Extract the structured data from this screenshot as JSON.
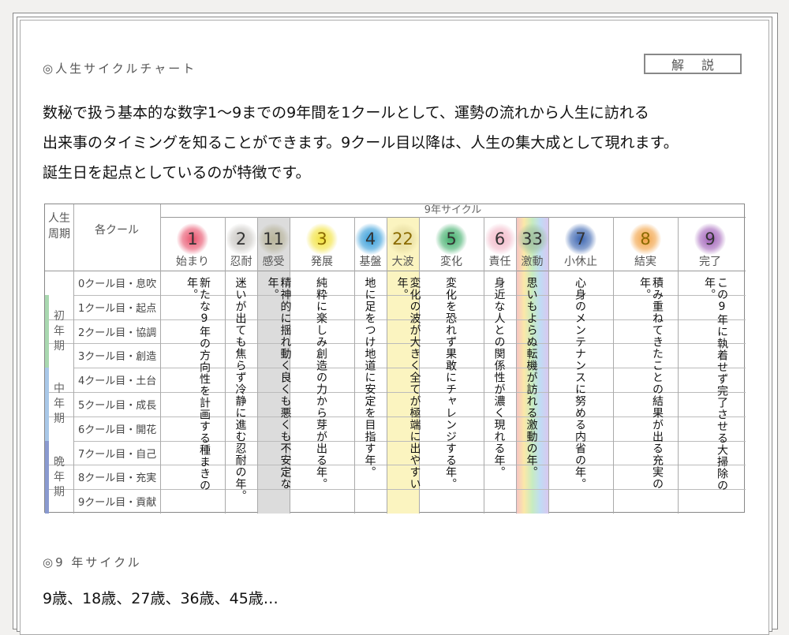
{
  "section1_title": "◎人生サイクルチャート",
  "kaisetsu_button": "解説",
  "intro": [
    "数秘で扱う基本的な数字1〜9までの9年間を1クールとして、運勢の流れから人生に訪れる",
    "出来事のタイミングを知ることができます。9クール目以降は、人生の集大成として現れます。",
    "誕生日を起点としているのが特徴です。"
  ],
  "table": {
    "col_header_life": "人生周期",
    "col_header_cour": "各クール",
    "cycle_header": "9年サイクル",
    "columns": [
      {
        "num": "1",
        "name": "始まり",
        "color": "#e8506a",
        "text": "新たな9年の方向性を計画する種まきの年。"
      },
      {
        "num": "2",
        "name": "忍耐",
        "color": "#c9c6c2",
        "text": "迷いが出ても焦らず冷静に進む忍耐の年。"
      },
      {
        "num": "11",
        "name": "感受",
        "color": "#b8b49a",
        "text": "精神的に揺れ動く良くも悪くも不安定な年。"
      },
      {
        "num": "3",
        "name": "発展",
        "color": "#f2e23c",
        "text": "純粋に楽しみ創造の力から芽が出る年。"
      },
      {
        "num": "4",
        "name": "基盤",
        "color": "#2f9ad8",
        "text": "地に足をつけ地道に安定を目指す年。"
      },
      {
        "num": "22",
        "name": "大波",
        "color": "#e6dca0",
        "text": "変化の波が大きく全てが極端に出やすい年。"
      },
      {
        "num": "5",
        "name": "変化",
        "color": "#3fae6a",
        "text": "変化を恐れず果敢にチャレンジする年。"
      },
      {
        "num": "6",
        "name": "責任",
        "color": "#f2b8c8",
        "text": "身近な人との関係性が濃く現れる年。"
      },
      {
        "num": "33",
        "name": "激動",
        "color": "#a0c0a0",
        "text": "思いもよらぬ転機が訪れる激動の年。"
      },
      {
        "num": "7",
        "name": "小休止",
        "color": "#3a64b0",
        "text": "心身のメンテナンスに努める内省の年。"
      },
      {
        "num": "8",
        "name": "結実",
        "color": "#f2a040",
        "text": "積み重ねてきたことの結果が出る充実の年。"
      },
      {
        "num": "9",
        "name": "完了",
        "color": "#a060b8",
        "text": "この9年に執着せず完了させる大掃除の年。"
      }
    ],
    "rows": [
      "0クール目・息吹",
      "1クール目・起点",
      "2クール目・協調",
      "3クール目・創造",
      "4クール目・土台",
      "5クール目・成長",
      "6クール目・開花",
      "7クール目・自己",
      "8クール目・充実",
      "9クール目・貢献"
    ],
    "phases": [
      {
        "label": "初年期",
        "color": "#a9d8b0"
      },
      {
        "label": "中年期",
        "color": "#a9c8e8"
      },
      {
        "label": "晩年期",
        "color": "#8a9ad0"
      }
    ]
  },
  "section2_title": "◎9 年サイクル",
  "section2_text": "9歳、18歳、27歳、36歳、45歳…"
}
